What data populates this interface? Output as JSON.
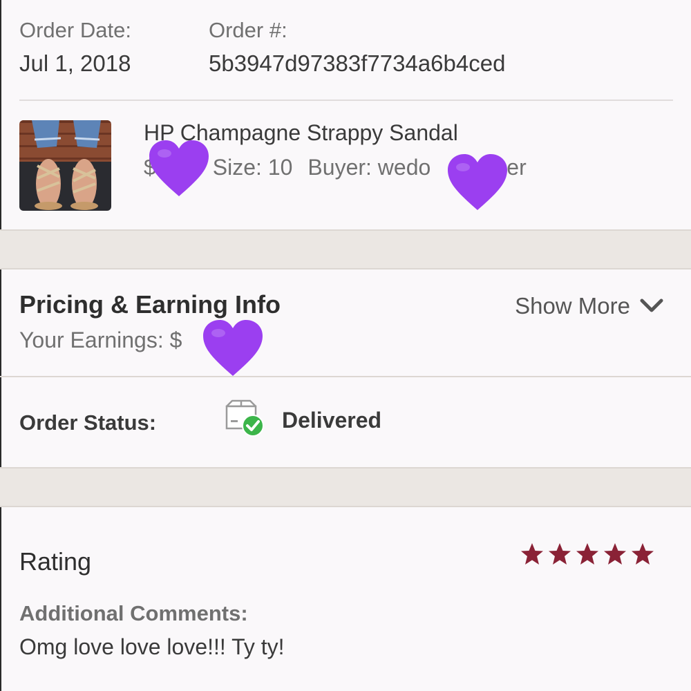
{
  "order": {
    "date_label": "Order Date:",
    "date_value": "Jul 1, 2018",
    "number_label": "Order #:",
    "number_value": "5b3947d97383f7734a6b4ced"
  },
  "item": {
    "title": "HP Champagne Strappy Sandal",
    "price_prefix": "$",
    "size_text": "Size: 10",
    "buyer_text": "Buyer: wedo",
    "buyer_suffix": "er",
    "heart_color": "#9b3ff0"
  },
  "pricing": {
    "title": "Pricing & Earning Info",
    "earnings_label": "Your Earnings: $",
    "show_more_label": "Show More"
  },
  "status": {
    "label": "Order Status:",
    "value": "Delivered",
    "check_color": "#3cb54a"
  },
  "rating": {
    "title": "Rating",
    "stars": 5,
    "star_color": "#8a2236",
    "comments_label": "Additional Comments:",
    "comments_text": "Omg love love love!!! Ty ty!"
  },
  "colors": {
    "background": "#faf8fa",
    "band": "#ebe7e3"
  }
}
